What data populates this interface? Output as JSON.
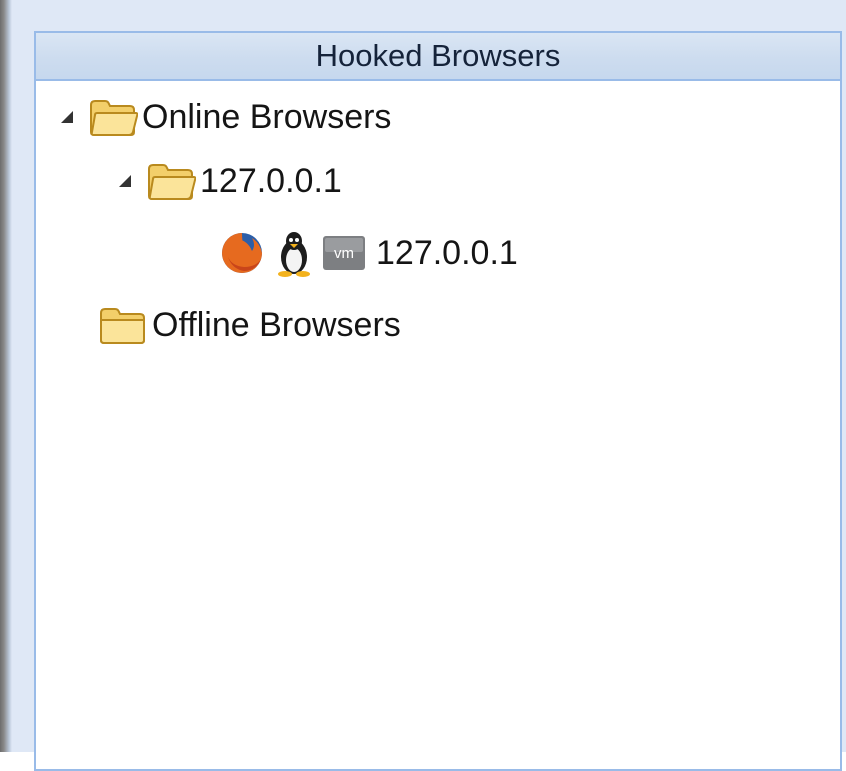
{
  "panel": {
    "title": "Hooked Browsers"
  },
  "tree": {
    "online": {
      "label": "Online Browsers",
      "expanded": true,
      "host": {
        "label": "127.0.0.1",
        "expanded": true,
        "browser": {
          "label": "127.0.0.1",
          "icons": [
            "firefox-icon",
            "linux-tux-icon",
            "vmware-icon"
          ]
        }
      }
    },
    "offline": {
      "label": "Offline Browsers",
      "expanded": false
    }
  },
  "colors": {
    "header_bg": "#cddcef",
    "panel_border": "#99bbe8",
    "folder_fill": "#f8d775",
    "folder_edge": "#c79a2a"
  }
}
